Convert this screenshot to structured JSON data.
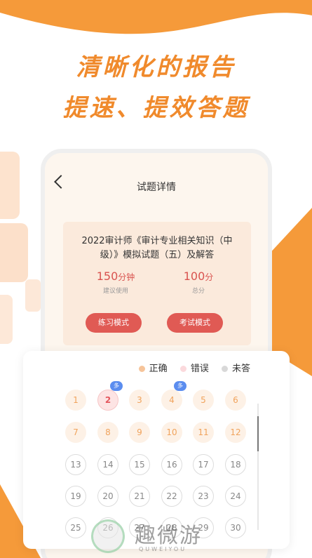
{
  "hero": {
    "line1": "清晰化的报告",
    "line2": "提速、提效答题"
  },
  "colors": {
    "accent": "#f08a2c",
    "button": "#e05a54",
    "correct": "#f0a35c",
    "wrong": "#e4565d",
    "tag": "#5b8def"
  },
  "header": {
    "back_icon": "chevron-left-icon",
    "title": "试题详情"
  },
  "exam": {
    "title": "2022审计师《审计专业相关知识（中级）》模拟试题（五）及解答",
    "duration_value": "150",
    "duration_unit": "分钟",
    "duration_label": "建议使用",
    "score_value": "100",
    "score_unit": "分",
    "score_label": "总分",
    "practice_button": "练习模式",
    "exam_button": "考试模式"
  },
  "legend": {
    "correct": "正确",
    "wrong": "错误",
    "unanswered": "未答"
  },
  "questions": [
    {
      "n": "1",
      "status": "correct"
    },
    {
      "n": "2",
      "status": "wrong",
      "tag": "多"
    },
    {
      "n": "3",
      "status": "correct"
    },
    {
      "n": "4",
      "status": "correct",
      "tag": "多"
    },
    {
      "n": "5",
      "status": "correct"
    },
    {
      "n": "6",
      "status": "correct"
    },
    {
      "n": "7",
      "status": "correct"
    },
    {
      "n": "8",
      "status": "correct"
    },
    {
      "n": "9",
      "status": "correct"
    },
    {
      "n": "10",
      "status": "correct"
    },
    {
      "n": "11",
      "status": "correct"
    },
    {
      "n": "12",
      "status": "correct"
    },
    {
      "n": "13",
      "status": "unanswered"
    },
    {
      "n": "14",
      "status": "unanswered"
    },
    {
      "n": "15",
      "status": "unanswered"
    },
    {
      "n": "16",
      "status": "unanswered"
    },
    {
      "n": "17",
      "status": "unanswered"
    },
    {
      "n": "18",
      "status": "unanswered"
    },
    {
      "n": "19",
      "status": "unanswered"
    },
    {
      "n": "20",
      "status": "unanswered"
    },
    {
      "n": "21",
      "status": "unanswered"
    },
    {
      "n": "22",
      "status": "unanswered"
    },
    {
      "n": "23",
      "status": "unanswered"
    },
    {
      "n": "24",
      "status": "unanswered"
    },
    {
      "n": "25",
      "status": "unanswered"
    },
    {
      "n": "26",
      "status": "unanswered"
    },
    {
      "n": "27",
      "status": "unanswered"
    },
    {
      "n": "28",
      "status": "unanswered"
    },
    {
      "n": "29",
      "status": "unanswered"
    },
    {
      "n": "30",
      "status": "unanswered"
    }
  ],
  "watermark": {
    "text": "趣微游",
    "sub": "QUWEIYOU"
  }
}
